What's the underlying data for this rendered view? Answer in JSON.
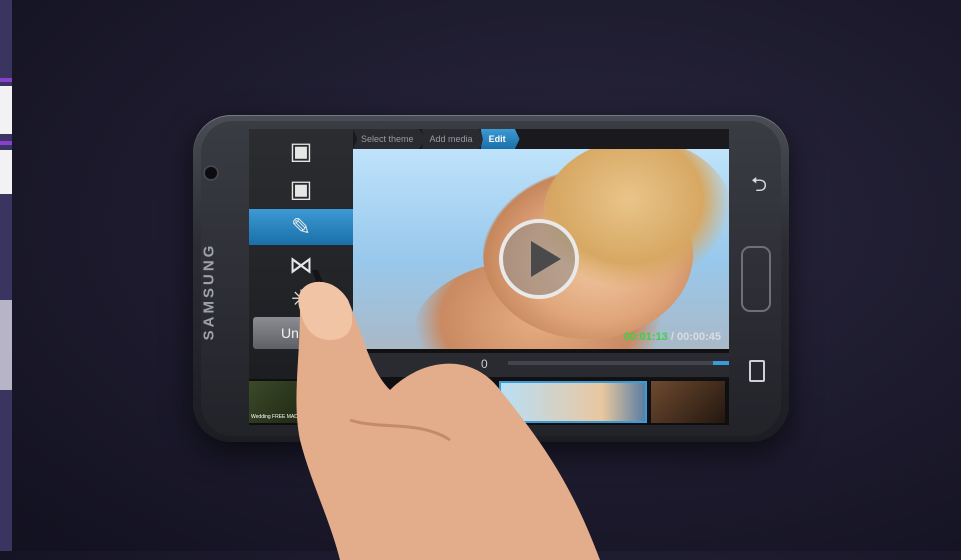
{
  "device": {
    "brand": "SAMSUNG"
  },
  "editor": {
    "tabs": [
      "Select theme",
      "Add media",
      "Edit"
    ],
    "active_tab": "Edit",
    "tools": [
      {
        "icon": "theme-frames-icon"
      },
      {
        "icon": "theme-clips-icon"
      },
      {
        "icon": "pen-icon",
        "active": true
      },
      {
        "icon": "transition-icon"
      },
      {
        "icon": "effects-sparkle-icon"
      }
    ],
    "undo_label": "Unc",
    "timeline_value": "0",
    "timecode": {
      "current": "00:01:13",
      "separator": " / ",
      "total": "00:00:45"
    },
    "thumb_caption": "Wedding FREE MADE",
    "accent": "#3b9bd8"
  }
}
